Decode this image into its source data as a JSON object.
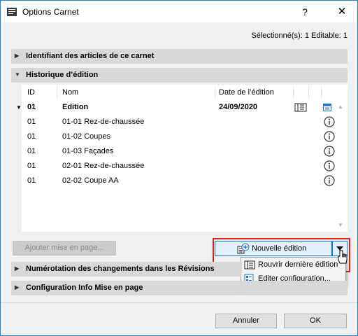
{
  "window": {
    "title": "Options Carnet",
    "help_glyph": "?",
    "close_glyph": "✕"
  },
  "selection_info": "Sélectionné(s): 1 Editable: 1",
  "sections": {
    "identifier": "Identifiant des articles de ce carnet",
    "history": "Historique d’édition",
    "numbering": "Numérotation des changements dans les Révisions",
    "config": "Configuration Info Mise en page"
  },
  "table": {
    "columns": [
      "ID",
      "Nom",
      "Date de l’édition"
    ],
    "parent": {
      "id": "01",
      "name": "Edition",
      "date": "24/09/2020"
    },
    "rows": [
      {
        "id": "01",
        "name": "01-01 Rez-de-chaussée"
      },
      {
        "id": "01",
        "name": "01-02 Coupes"
      },
      {
        "id": "01",
        "name": "01-03 Façades"
      },
      {
        "id": "01",
        "name": "02-01 Rez-de-chaussée"
      },
      {
        "id": "01",
        "name": "02-02 Coupe AA"
      }
    ]
  },
  "buttons": {
    "add_layout": "Ajouter mise en page...",
    "new_edition": "Nouvelle édition",
    "cancel": "Annuler",
    "ok": "OK"
  },
  "dropdown_menu": {
    "items": [
      "Rouvrir dernière édition",
      "Editer configuration..."
    ]
  },
  "colors": {
    "accent": "#0078d7",
    "highlight_border": "#e02020",
    "info_icon": "#333333"
  },
  "icons": {
    "section_collapsed": "triangle-right-icon",
    "section_expanded": "triangle-down-icon",
    "info": "info-circle-icon",
    "new_edition": "new-edition-icon",
    "reopen": "reopen-edition-icon",
    "edit_config": "edit-config-icon"
  }
}
